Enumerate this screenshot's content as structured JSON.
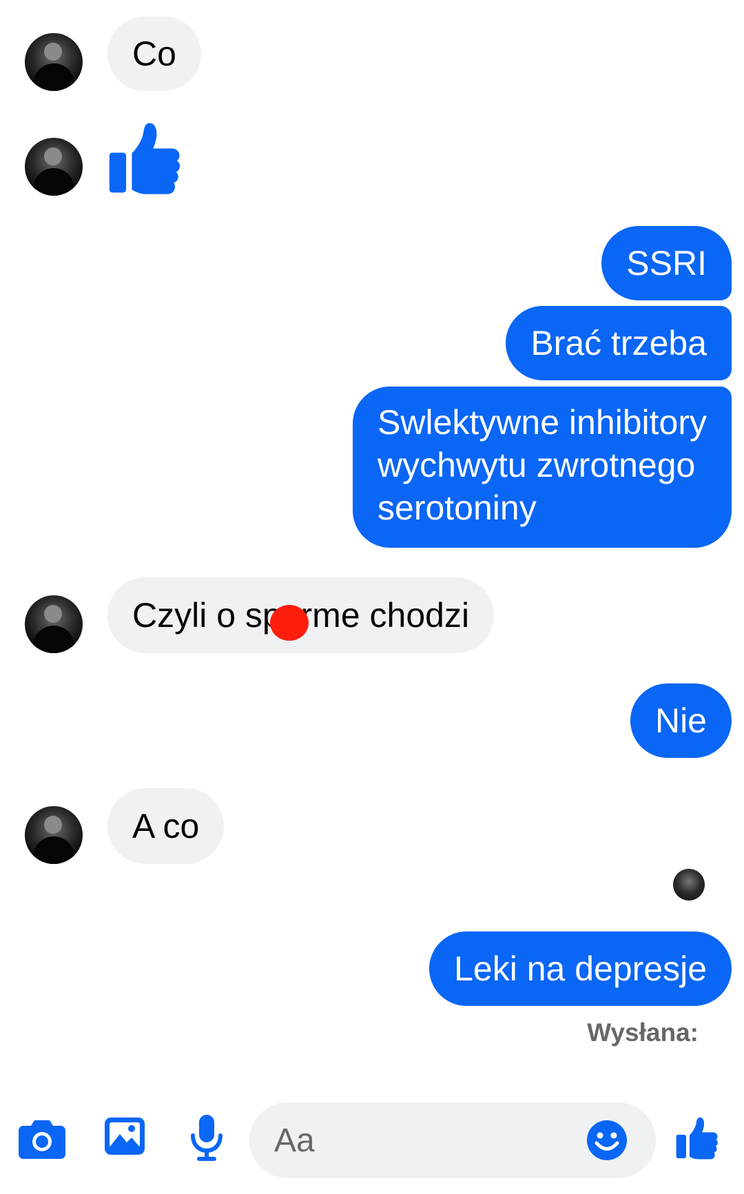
{
  "messages": {
    "m1": "Co",
    "m3": "SSRI",
    "m4": "Brać trzeba",
    "m5_line1": "Swlektywne inhibitory",
    "m5_line2": "wychwytu zwrotnego",
    "m5_line3": "serotoniny",
    "m6": "Czyli o sperme chodzi",
    "m7": "Nie",
    "m8": "A co",
    "m9": "Leki na depresje"
  },
  "status": {
    "sent_label": "Wysłana:"
  },
  "composer": {
    "placeholder": "Aa"
  },
  "colors": {
    "outgoing_bubble": "#0a66f5",
    "incoming_bubble": "#f0f1f3",
    "accent": "#0a66f5"
  },
  "icons": {
    "like": "thumbs-up-icon",
    "camera": "camera-icon",
    "gallery": "image-icon",
    "mic": "microphone-icon",
    "emoji": "smiley-icon"
  }
}
